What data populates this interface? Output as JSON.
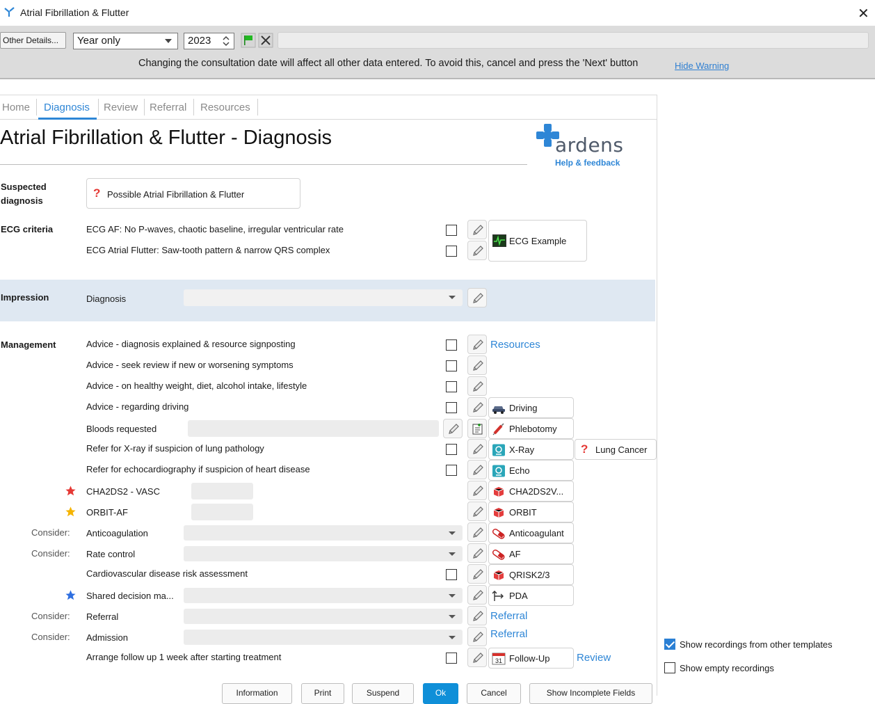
{
  "window": {
    "title": "Atrial Fibrillation & Flutter",
    "close_glyph": "✕"
  },
  "toolbar": {
    "other_details": "Other Details...",
    "date_mode": "Year only",
    "year": "2023",
    "warning": "Changing the consultation date will affect all other data entered. To avoid this, cancel and press the 'Next' button",
    "hide_warning": "Hide Warning"
  },
  "tabs": [
    "Home",
    "Diagnosis",
    "Review",
    "Referral",
    "Resources"
  ],
  "active_tab": "Diagnosis",
  "page": {
    "title": "Atrial Fibrillation & Flutter - Diagnosis",
    "logo": "ardens",
    "help": "Help & feedback"
  },
  "suspected": {
    "label_1": "Suspected",
    "label_2": "diagnosis",
    "button": "Possible Atrial Fibrillation & Flutter"
  },
  "ecg": {
    "label": "ECG criteria",
    "items": [
      "ECG AF: No P-waves, chaotic baseline, irregular ventricular rate",
      "ECG Atrial Flutter: Saw-tooth pattern & narrow QRS complex"
    ],
    "example": "ECG Example"
  },
  "impression": {
    "label": "Impression",
    "diagnosis": "Diagnosis",
    "value": ""
  },
  "management": {
    "label": "Management",
    "consider": "Consider:",
    "rows": {
      "advice1": "Advice - diagnosis explained & resource signposting",
      "advice2": "Advice - seek review if new or worsening symptoms",
      "advice3": "Advice - on healthy weight, diet, alcohol intake, lifestyle",
      "advice4": "Advice - regarding driving",
      "bloods": "Bloods requested",
      "xray": "Refer for X-ray if suspicion of lung pathology",
      "echo": "Refer for echocardiography if suspicion of heart disease",
      "cha": "CHA2DS2 - VASC",
      "orbit": "ORBIT-AF",
      "anticoag": "Anticoagulation",
      "rate": "Rate control",
      "cvd": "Cardiovascular disease risk assessment",
      "shared": "Shared decision ma...",
      "referral": "Referral",
      "admission": "Admission",
      "followup": "Arrange follow up 1 week after starting treatment"
    },
    "cards": {
      "resources": "Resources",
      "driving": "Driving",
      "phlebotomy": "Phlebotomy",
      "xray": "X-Ray",
      "lung": "Lung Cancer",
      "echo": "Echo",
      "cha": "CHA2DS2V...",
      "orbit": "ORBIT",
      "anticoagulant": "Anticoagulant",
      "af": "AF",
      "qrisk": "QRISK2/3",
      "pda": "PDA",
      "referral1": "Referral",
      "referral2": "Referral",
      "followup": "Follow-Up",
      "review": "Review",
      "calendar_day": "31"
    },
    "star_colors": {
      "cha": "#e53935",
      "orbit": "#f5b400",
      "shared": "#2f6fe0"
    }
  },
  "options": {
    "show_other": {
      "label": "Show recordings from other templates",
      "checked": true
    },
    "show_empty": {
      "label": "Show empty recordings",
      "checked": false
    }
  },
  "footer": [
    "Information",
    "Print",
    "Suspend",
    "Ok",
    "Cancel",
    "Show Incomplete Fields"
  ]
}
